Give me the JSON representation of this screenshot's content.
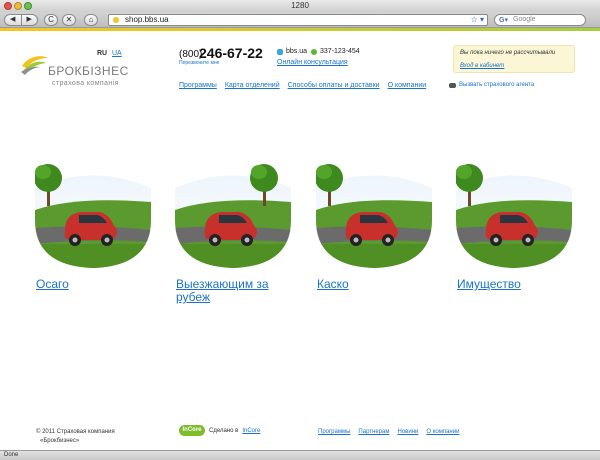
{
  "browser": {
    "window_title": "1280",
    "url": "shop.bbs.ua",
    "search_placeholder": "Google",
    "status": "Done",
    "nav_back": "◀",
    "nav_forward": "▶",
    "reload": "C",
    "stop": "✕",
    "home": "⌂",
    "bookmark_icon": "☆",
    "reader_icon": "▾"
  },
  "header": {
    "logo_name": "БРОКБІЗНЕС",
    "logo_sub": "страхова компанія",
    "lang_ru": "RU",
    "lang_ua": "UA",
    "phone_code": "(800)",
    "phone_number": "246-67-22",
    "callback": "Перезвоните мне",
    "twitter": "bbs.ua",
    "icq": "337-123-454",
    "consult": "Онлайн консультация",
    "cabinet_text": "Вы пока ничего не рассчитывали",
    "cabinet_link": "Вход в кабинет",
    "agent": "Вызвать страхового агента"
  },
  "nav": {
    "items": [
      "Программы",
      "Карта отделений",
      "Способы оплаты и доставки",
      "О компании"
    ]
  },
  "products": [
    {
      "title": "Осаго"
    },
    {
      "title": "Выезжающим за рубеж"
    },
    {
      "title": "Каско"
    },
    {
      "title": "Имущество"
    }
  ],
  "footer": {
    "copyright_1": "© 2011 Страховая компания",
    "copyright_2": "«Брокбизнес»",
    "incore_logo": "InCore",
    "made_by": "Сделано в",
    "made_by_link": "InCore",
    "links": [
      "Программы",
      "Партнерам",
      "Новини",
      "О компании"
    ]
  },
  "colors": {
    "link": "#1a73c8",
    "accent_yellow": "#f6c627",
    "accent_green": "#a5cf3d",
    "car_red": "#c8302b"
  }
}
